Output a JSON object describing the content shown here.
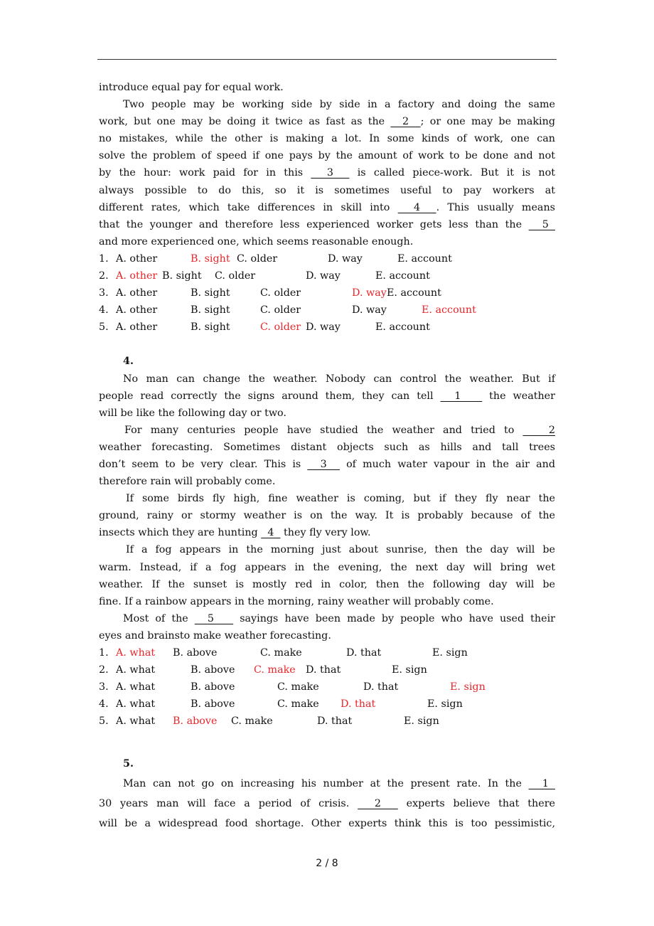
{
  "passage3_tail": {
    "lines": [
      "introduce equal pay for equal work.",
      [
        "Two people may be working side by side in a factory and doing the same"
      ],
      [
        "work, but one may be doing it twice as fast as the ",
        "  2  ",
        "; or one may be making"
      ],
      "no mistakes, while the other is making a lot. In some kinds of work, one can",
      "solve the problem of speed if one pays by the amount of work to be done and not",
      [
        "by the hour: work paid for in this ",
        "  3  ",
        " is called piece-work. But it is not"
      ],
      "always possible to do this, so it is sometimes useful to pay workers at",
      [
        "different rates, which take differences in skill into ",
        "  4  ",
        ". This usually means"
      ],
      [
        "that the younger and therefore less experienced worker gets less than the ",
        "  5  "
      ],
      "and more experienced one, which seems reasonable enough."
    ],
    "options": [
      {
        "num": "1.",
        "choices": [
          "A. other",
          "B. sight",
          "C. older",
          "D. way",
          "E. account"
        ],
        "answer": 1
      },
      {
        "num": "2.",
        "choices": [
          "A. other",
          "B. sight",
          "C. older",
          "D. way",
          "E. account"
        ],
        "answer": 0
      },
      {
        "num": "3.",
        "choices": [
          "A. other",
          "B. sight",
          "C. older",
          "D. way",
          "E. account"
        ],
        "answer": 3
      },
      {
        "num": "4.",
        "choices": [
          "A. other",
          "B. sight",
          "C. older",
          "D. way",
          "E. account"
        ],
        "answer": 4
      },
      {
        "num": "5.",
        "choices": [
          "A. other",
          "B. sight",
          "C. older",
          "D. way",
          "E. account"
        ],
        "answer": 2
      }
    ]
  },
  "section4": {
    "number": "4.",
    "l1": "No man can change the weather. Nobody can control the weather. But if",
    "l2a": "people read correctly the signs around them, they can tell ",
    "l2b": "  1   ",
    "l2c": " the weather",
    "l3": "will be like the following day or two.",
    "l4a": "For many centuries people have studied the weather and tried to ",
    "l4b": "   2",
    "l5": "weather forecasting. Sometimes distant objects such as hills and tall trees",
    "l6a": "don’t seem to be very clear. This is ",
    "l6b": "  3  ",
    "l6c": " of much water vapour in the air and",
    "l7": "therefore rain will probably come.",
    "l8": "If some birds fly high, fine weather is coming, but if they fly near the",
    "l9": "ground, rainy or stormy weather is on the way. It is probably because of the",
    "l10a": "insects which they are hunting ",
    "l10b": "  4  ",
    "l10c": " they fly very low.",
    "l11": "If a fog appears in the morning just about sunrise, then the day will be",
    "l12": "warm. Instead, if a fog appears in the evening, the next day will bring wet",
    "l13": "weather. If the sunset is mostly red in color, then the following day will be",
    "l14": "fine. If a rainbow appears in the morning, rainy weather will probably come.",
    "l15a": "Most of the ",
    "l15b": "  5   ",
    "l15c": " sayings have been made by people who have used their",
    "l16": " eyes and brainsto make weather forecasting.",
    "options": [
      {
        "num": "1.",
        "choices": [
          "A. what",
          "B. above",
          "C. make",
          "D. that",
          "E. sign"
        ],
        "answer": 0
      },
      {
        "num": "2.",
        "choices": [
          "A. what",
          "B. above",
          "C. make",
          "D. that",
          "E. sign"
        ],
        "answer": 2
      },
      {
        "num": "3.",
        "choices": [
          "A. what",
          "B. above",
          "C. make",
          "D. that",
          "E. sign"
        ],
        "answer": 4
      },
      {
        "num": "4.",
        "choices": [
          "A. what",
          "B. above",
          "C. make",
          "D. that",
          "E. sign"
        ],
        "answer": 3
      },
      {
        "num": "5.",
        "choices": [
          "A. what",
          "B. above",
          "C. make",
          "D. that",
          "E. sign"
        ],
        "answer": 1
      }
    ]
  },
  "section5": {
    "number": "5.",
    "l1a": "Man can not go on increasing his number at the present rate. In the ",
    "l1b": "  1  ",
    "l2a": "30 years man will face a period of crisis. ",
    "l2b": "  2  ",
    "l2c": " experts believe that there",
    "l3": "will be a widespread food shortage. Other experts think this is too pessimistic,"
  },
  "footer": {
    "page_indicator": "2 / 8"
  },
  "colors": {
    "answer": "#e8262b",
    "text": "#111111"
  }
}
